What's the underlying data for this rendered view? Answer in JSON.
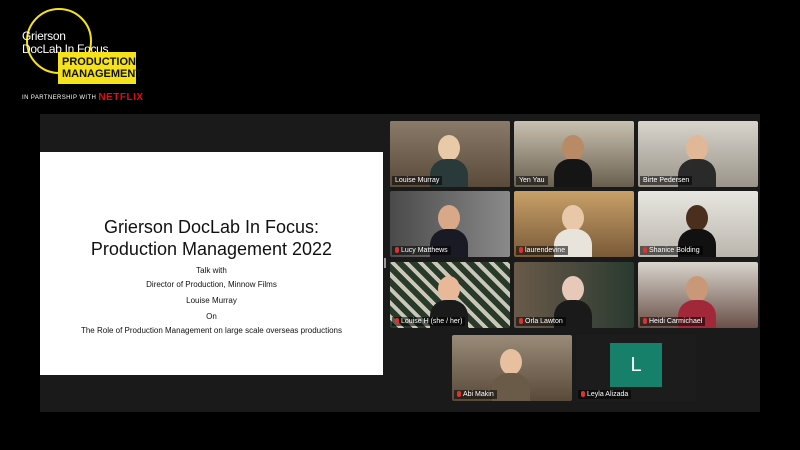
{
  "logo": {
    "line1": "Grierson",
    "line2": "DocLab In Focus",
    "badge_line1": "PRODUCTION",
    "badge_line2": "MANAGEMENT",
    "partner_text": "IN PARTNERSHIP WITH",
    "partner_brand": "NETFLIX"
  },
  "slide": {
    "title_line1": "Grierson DocLab In Focus:",
    "title_line2": "Production Management 2022",
    "line1": "Talk with",
    "line2": "Director of Production, Minnow Films",
    "line3": "Louise Murray",
    "line4": "On",
    "line5": "The Role of Production Management on large scale overseas productions"
  },
  "participants": [
    {
      "name": "Louise Murray",
      "muted": false,
      "active": true
    },
    {
      "name": "Yen Yau",
      "muted": false,
      "active": false
    },
    {
      "name": "Birte Pedersen",
      "muted": false,
      "active": false
    },
    {
      "name": "Lucy Matthews",
      "muted": true,
      "active": false
    },
    {
      "name": "laurendevine",
      "muted": true,
      "active": false
    },
    {
      "name": "Shanice Bolding",
      "muted": true,
      "active": false
    },
    {
      "name": "Louise H (she / her)",
      "muted": true,
      "active": false
    },
    {
      "name": "Orla Lawton",
      "muted": true,
      "active": false
    },
    {
      "name": "Heidi Carmichael",
      "muted": true,
      "active": false
    },
    {
      "name": "Abi Makin",
      "muted": true,
      "active": false
    },
    {
      "name": "Leyla Alizada",
      "muted": true,
      "active": false,
      "avatar_letter": "L"
    }
  ],
  "colors": {
    "brand_yellow": "#f5e21a",
    "netflix_red": "#e50914",
    "active_speaker": "#4ad35a",
    "avatar_green": "#17806a"
  }
}
